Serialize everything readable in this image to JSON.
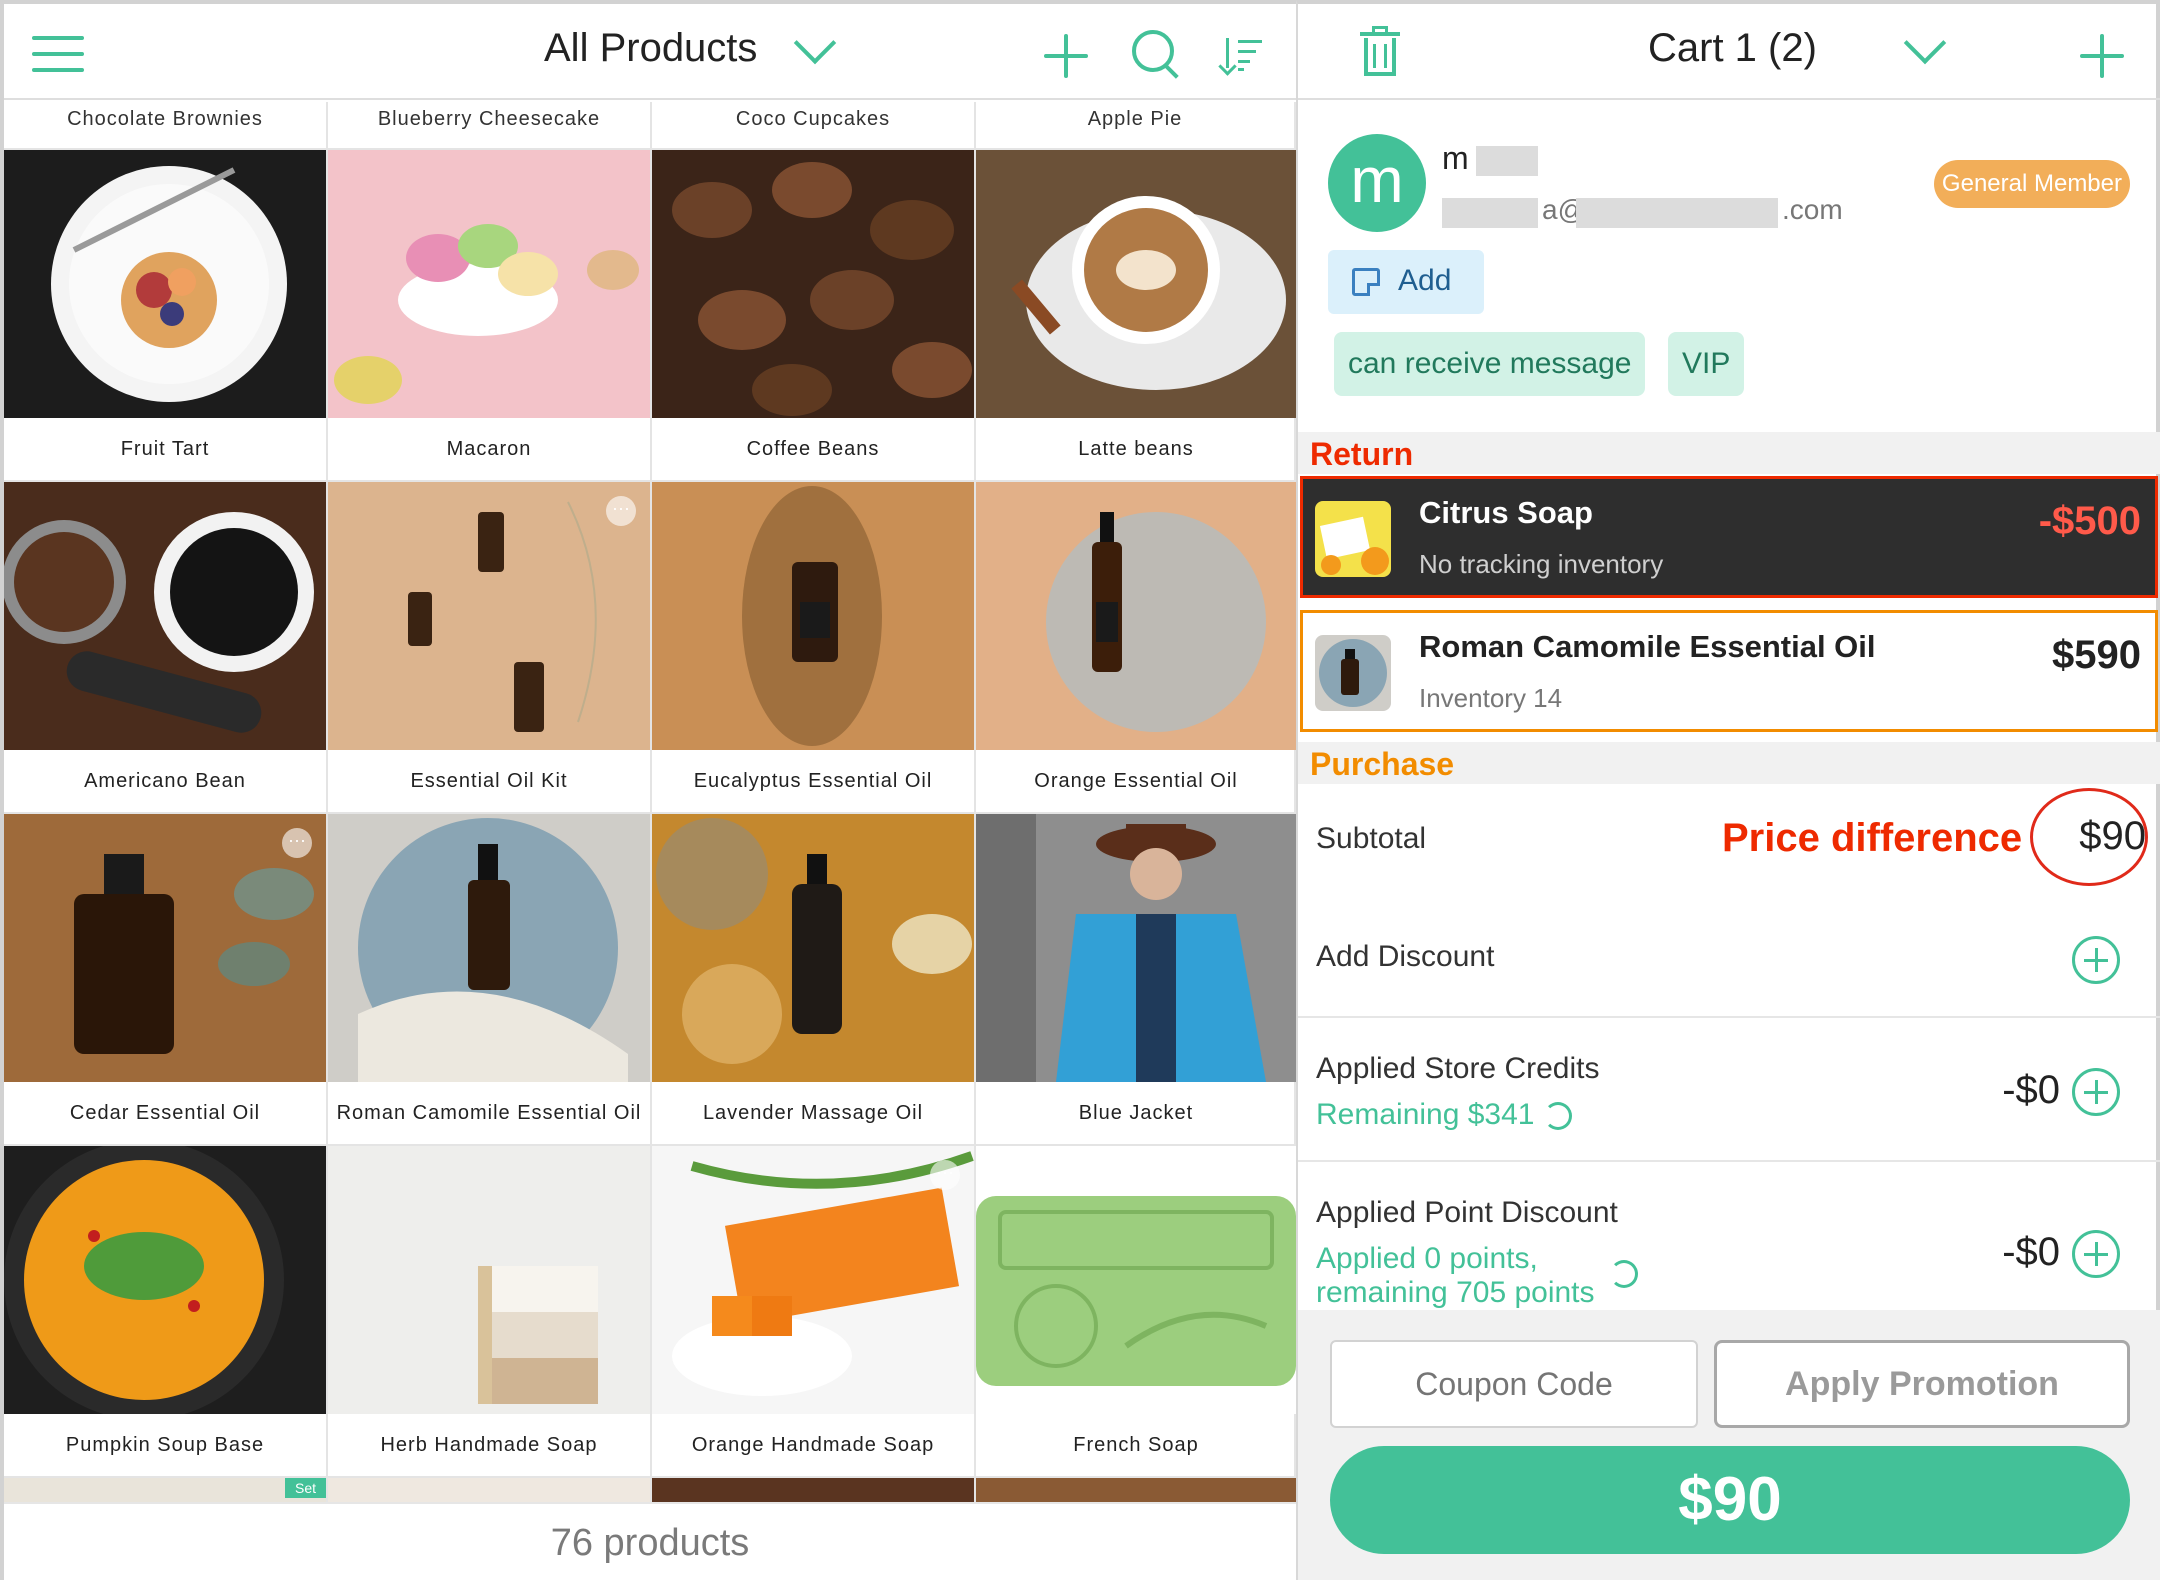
{
  "left_header": {
    "title": "All Products"
  },
  "grid_top_labels": [
    "Chocolate Brownies",
    "Blueberry Cheesecake",
    "Coco Cupcakes",
    "Apple Pie"
  ],
  "products": [
    {
      "name": "Fruit Tart"
    },
    {
      "name": "Macaron"
    },
    {
      "name": "Coffee Beans"
    },
    {
      "name": "Latte beans"
    },
    {
      "name": "Americano Bean"
    },
    {
      "name": "Essential Oil Kit"
    },
    {
      "name": "Eucalyptus Essential Oil"
    },
    {
      "name": "Orange Essential Oil"
    },
    {
      "name": "Cedar Essential Oil"
    },
    {
      "name": "Roman Camomile Essential Oil"
    },
    {
      "name": "Lavender Massage Oil"
    },
    {
      "name": "Blue Jacket"
    },
    {
      "name": "Pumpkin Soup Base"
    },
    {
      "name": "Herb Handmade Soap"
    },
    {
      "name": "Orange Handmade Soap"
    },
    {
      "name": "French Soap"
    }
  ],
  "partial_badge": "Set",
  "footer": {
    "product_count": "76 products"
  },
  "cart_header": {
    "title": "Cart 1 (2)"
  },
  "customer": {
    "avatar_letter": "m",
    "name": "m",
    "email_at": "a@",
    "email_domain": ".com",
    "member_level": "General Member",
    "add_note_label": "Add",
    "tags": [
      "can receive message",
      "VIP"
    ]
  },
  "return_section": {
    "label": "Return",
    "item": {
      "title": "Citrus Soap",
      "subtitle": "No tracking inventory",
      "price": "-$500"
    }
  },
  "exchange_item": {
    "title": "Roman Camomile Essential Oil",
    "subtitle": "Inventory 14",
    "price": "$590"
  },
  "purchase_section": {
    "label": "Purchase"
  },
  "summary": {
    "subtotal_label": "Subtotal",
    "price_difference_label": "Price difference",
    "subtotal_value": "$90",
    "discount_label": "Add Discount",
    "store_credit_label": "Applied Store Credits",
    "store_credit_remaining": "Remaining $341",
    "store_credit_value": "-$0",
    "point_label": "Applied Point Discount",
    "point_applied": "Applied 0 points,",
    "point_remaining": "remaining 705 points",
    "point_value": "-$0"
  },
  "actions": {
    "coupon_placeholder": "Coupon Code",
    "apply_promotion": "Apply Promotion",
    "pay_total": "$90"
  },
  "colors": {
    "accent": "#43c198",
    "return_red": "#ee2a00",
    "purchase_orange": "#f28c00",
    "member_badge": "#f2ae59"
  }
}
